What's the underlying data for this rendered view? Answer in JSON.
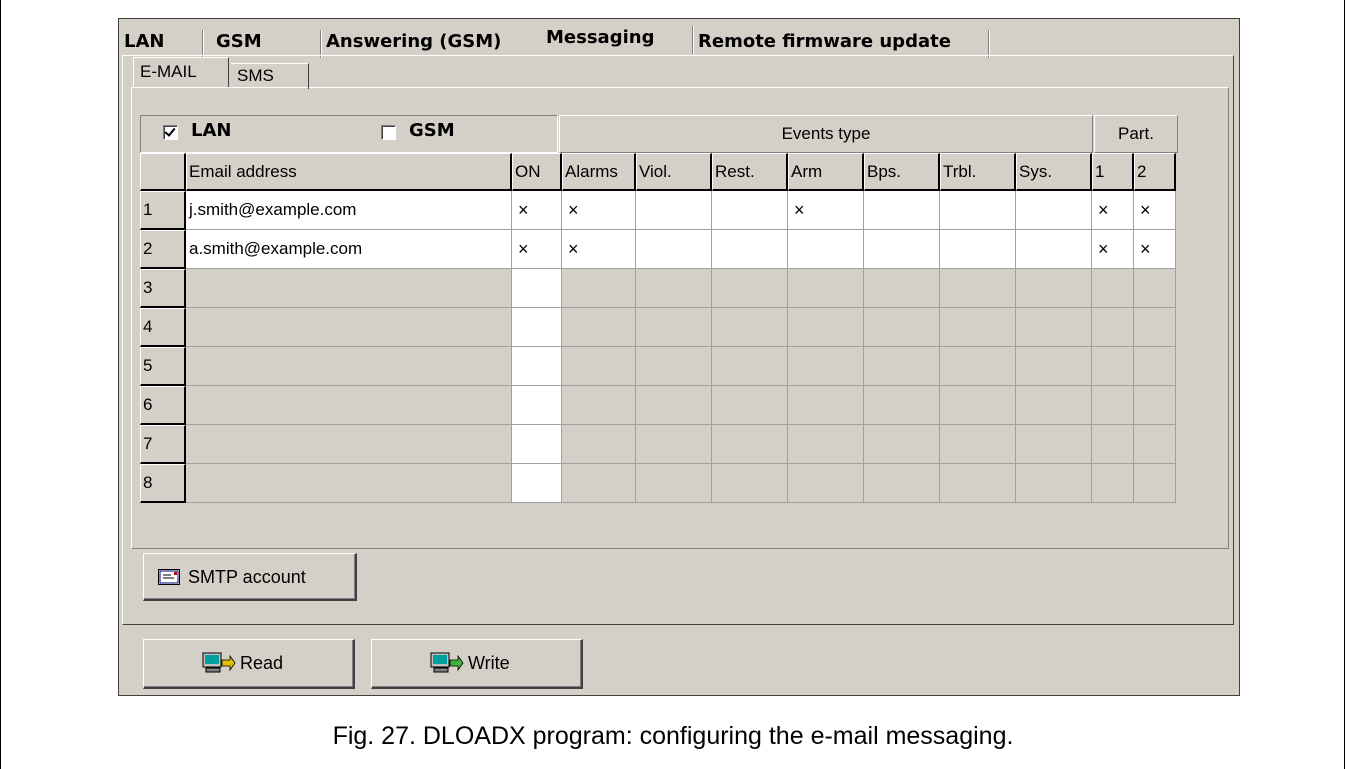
{
  "main_tabs": [
    {
      "label": "LAN"
    },
    {
      "label": "GSM"
    },
    {
      "label": "Answering (GSM)"
    },
    {
      "label": "Messaging"
    },
    {
      "label": "Remote firmware update"
    }
  ],
  "active_main_tab": "Messaging",
  "sub_tabs": [
    {
      "label": "E-MAIL"
    },
    {
      "label": "SMS"
    }
  ],
  "active_sub_tab": "E-MAIL",
  "channels": {
    "lan": {
      "label": "LAN",
      "checked": true
    },
    "gsm": {
      "label": "GSM",
      "checked": false
    }
  },
  "group_headers": {
    "events": "Events type",
    "partitions": "Part."
  },
  "table": {
    "columns": [
      "Email address",
      "ON",
      "Alarms",
      "Viol.",
      "Rest.",
      "Arm",
      "Bps.",
      "Trbl.",
      "Sys.",
      "1",
      "2"
    ],
    "rows": [
      {
        "n": "1",
        "cells": [
          "j.smith@example.com",
          "×",
          "×",
          "",
          "",
          "×",
          "",
          "",
          "",
          "×",
          "×"
        ]
      },
      {
        "n": "2",
        "cells": [
          "a.smith@example.com",
          "×",
          "×",
          "",
          "",
          "",
          "",
          "",
          "",
          "×",
          "×"
        ]
      },
      {
        "n": "3",
        "cells": [
          "",
          "",
          "",
          "",
          "",
          "",
          "",
          "",
          "",
          "",
          ""
        ]
      },
      {
        "n": "4",
        "cells": [
          "",
          "",
          "",
          "",
          "",
          "",
          "",
          "",
          "",
          "",
          ""
        ]
      },
      {
        "n": "5",
        "cells": [
          "",
          "",
          "",
          "",
          "",
          "",
          "",
          "",
          "",
          "",
          ""
        ]
      },
      {
        "n": "6",
        "cells": [
          "",
          "",
          "",
          "",
          "",
          "",
          "",
          "",
          "",
          "",
          ""
        ]
      },
      {
        "n": "7",
        "cells": [
          "",
          "",
          "",
          "",
          "",
          "",
          "",
          "",
          "",
          "",
          ""
        ]
      },
      {
        "n": "8",
        "cells": [
          "",
          "",
          "",
          "",
          "",
          "",
          "",
          "",
          "",
          "",
          ""
        ]
      }
    ]
  },
  "buttons": {
    "smtp": {
      "label": "SMTP account",
      "icon": "envelope-icon"
    },
    "read": {
      "label": "Read",
      "icon": "read-computer-icon"
    },
    "write": {
      "label": "Write",
      "icon": "write-computer-icon"
    }
  },
  "caption": "Fig. 27. DLOADX program: configuring the e-mail messaging."
}
